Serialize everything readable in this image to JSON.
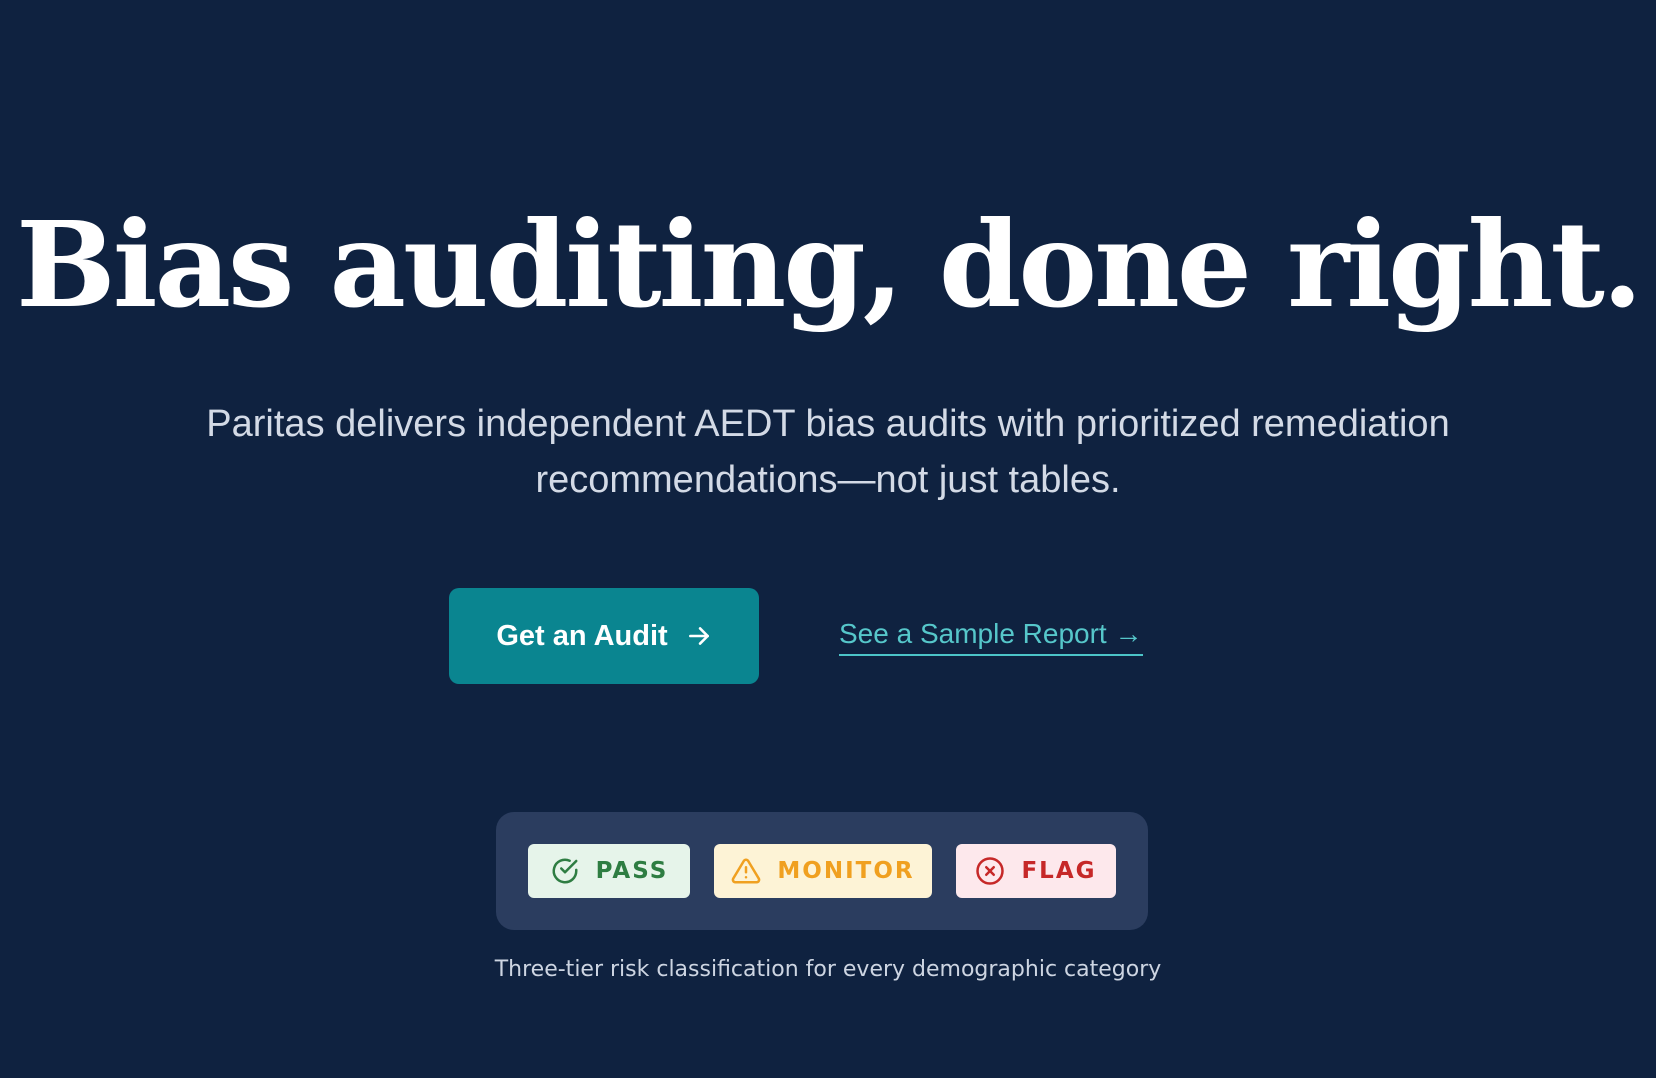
{
  "hero": {
    "headline": "Bias auditing, done right.",
    "subhead": "Paritas delivers independent AEDT bias audits with prioritized remediation recommendations—not just tables."
  },
  "cta": {
    "primary_label": "Get an Audit",
    "primary_icon": "arrow-right-icon",
    "secondary_label": "See a Sample Report →"
  },
  "risk_legend": {
    "badges": [
      {
        "label": "PASS",
        "icon": "check-circle-icon",
        "color": "#2e7d42",
        "background": "#e6f4ea"
      },
      {
        "label": "MONITOR",
        "icon": "warning-triangle-icon",
        "color": "#f0a020",
        "background": "#fdf3d6"
      },
      {
        "label": "FLAG",
        "icon": "x-circle-icon",
        "color": "#c62828",
        "background": "#fde8ec"
      }
    ],
    "caption": "Three-tier risk classification for every demographic category"
  },
  "colors": {
    "background": "#0f2240",
    "primary_button": "#0a8590",
    "link": "#56c7ca",
    "panel": "#2b3d5f"
  }
}
